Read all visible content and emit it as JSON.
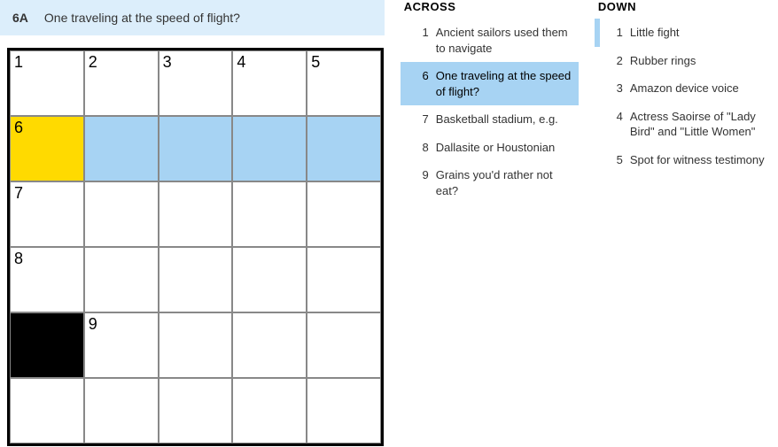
{
  "current": {
    "label": "6A",
    "text": "One traveling at the speed of flight?"
  },
  "grid": {
    "rows": 6,
    "cols": 5,
    "cells": [
      [
        {
          "n": "1"
        },
        {
          "n": "2"
        },
        {
          "n": "3"
        },
        {
          "n": "4"
        },
        {
          "n": "5"
        }
      ],
      [
        {
          "n": "6",
          "s": "cursor"
        },
        {
          "s": "hl"
        },
        {
          "s": "hl"
        },
        {
          "s": "hl"
        },
        {
          "s": "hl"
        }
      ],
      [
        {
          "n": "7"
        },
        {},
        {},
        {},
        {}
      ],
      [
        {
          "n": "8"
        },
        {},
        {},
        {},
        {}
      ],
      [
        {
          "s": "black"
        },
        {
          "n": "9"
        },
        {},
        {},
        {}
      ],
      [
        {},
        {},
        {},
        {},
        {}
      ]
    ]
  },
  "across": {
    "title": "ACROSS",
    "clues": [
      {
        "n": "1",
        "t": "Ancient sailors used them to navigate"
      },
      {
        "n": "6",
        "t": "One traveling at the speed of flight?",
        "active": true
      },
      {
        "n": "7",
        "t": "Basketball stadium, e.g."
      },
      {
        "n": "8",
        "t": "Dallasite or Houstonian"
      },
      {
        "n": "9",
        "t": "Grains you'd rather not eat?"
      }
    ]
  },
  "down": {
    "title": "DOWN",
    "clues": [
      {
        "n": "1",
        "t": "Little fight",
        "rel": true
      },
      {
        "n": "2",
        "t": "Rubber rings"
      },
      {
        "n": "3",
        "t": "Amazon device voice"
      },
      {
        "n": "4",
        "t": "Actress Saoirse of \"Lady Bird\" and \"Little Women\""
      },
      {
        "n": "5",
        "t": "Spot for witness testimony"
      }
    ]
  }
}
